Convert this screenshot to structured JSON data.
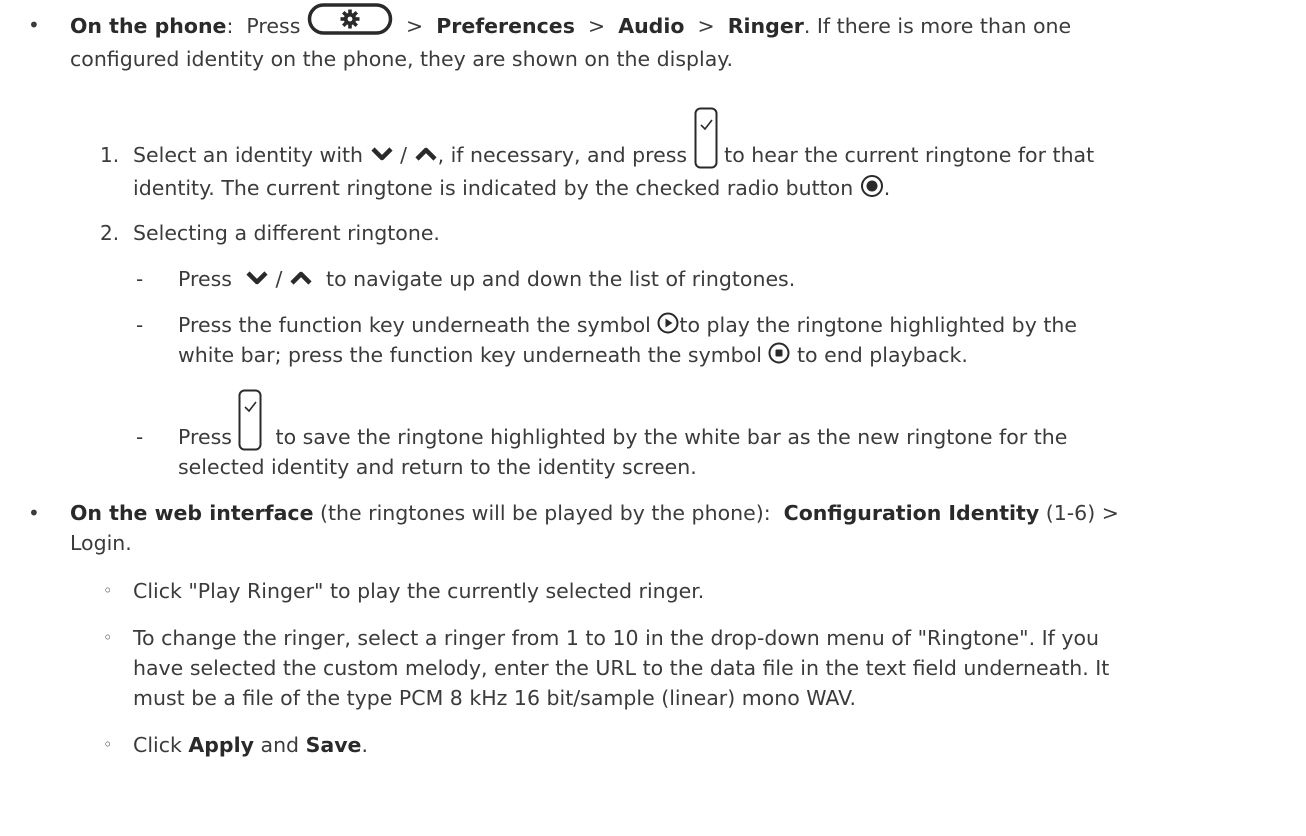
{
  "bullet_phone": {
    "marker": "•",
    "lead": "On the phone",
    "colon": ":",
    "press": "Press",
    "sep1": ">",
    "preferences": "Preferences",
    "sep2": ">",
    "audio": "Audio",
    "sep3": ">",
    "ringer": "Ringer",
    "tail": ". If there is more than one",
    "line2": "configured identity on the phone, they are shown on the display."
  },
  "step1": {
    "number": "1.",
    "a": "Select an identity with",
    "slash": "/",
    "b": ", if necessary, and press",
    "c": "to hear the current ringtone for that",
    "line2": "identity.  The current ringtone is indicated by the checked radio button",
    "line2_end": "."
  },
  "step2": {
    "number": "2.",
    "text": "Selecting a different ringtone.",
    "dash1": {
      "marker": "-",
      "a": "Press",
      "slash": "/",
      "b": "to navigate up and down the list of ringtones."
    },
    "dash2": {
      "marker": "-",
      "a": "Press the function key underneath the symbol",
      "b": "to play the ringtone highlighted by the",
      "line2a": "white bar; press the function key underneath the symbol",
      "line2b": "to end playback."
    },
    "dash3": {
      "marker": "-",
      "a": "Press",
      "b": "to save the ringtone highlighted by the white bar as the new ringtone for the",
      "line2": "selected identity and return to the identity screen."
    }
  },
  "bullet_web": {
    "marker": "•",
    "lead": "On the web interface",
    "text1": " (the ringtones will be played by the phone):  ",
    "config": "Configuration Identity",
    "text2": " (1-6) >",
    "line2": "Login.",
    "sub1": {
      "marker": "◦",
      "text": "Click \"Play Ringer\" to play the currently selected ringer."
    },
    "sub2": {
      "marker": "◦",
      "line1": "To change the ringer, select a ringer from 1 to 10 in the drop-down menu of \"Ringtone\".  If you",
      "line2": "have selected the custom melody, enter the URL to the data file in the text field underneath.  It",
      "line3": "must be a file of the type PCM 8 kHz 16 bit/sample (linear) mono WAV."
    },
    "sub3": {
      "marker": "◦",
      "a": "Click ",
      "apply": "Apply",
      "and": " and ",
      "save": "Save",
      "end": "."
    }
  },
  "icons": {
    "settings_key": "gear-key-icon",
    "down": "chevron-down-icon",
    "up": "chevron-up-icon",
    "ok": "ok-key-icon",
    "radio": "radio-checked-icon",
    "play": "play-icon",
    "stop": "stop-icon"
  },
  "colors": {
    "text": "#3b3b3b",
    "icon": "#2a2a2a"
  }
}
